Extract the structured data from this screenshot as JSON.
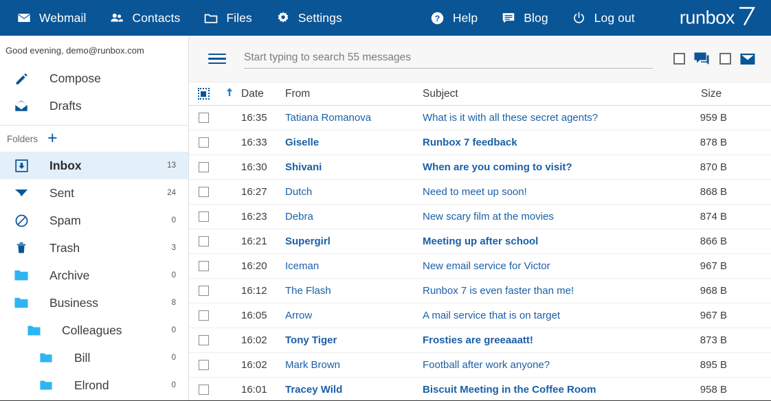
{
  "topnav": {
    "left_items": [
      {
        "label": "Webmail",
        "icon": "envelope-icon"
      },
      {
        "label": "Contacts",
        "icon": "people-icon"
      },
      {
        "label": "Files",
        "icon": "folder-icon"
      },
      {
        "label": "Settings",
        "icon": "gear-icon"
      }
    ],
    "right_items": [
      {
        "label": "Help",
        "icon": "help-circle-icon"
      },
      {
        "label": "Blog",
        "icon": "blog-icon"
      },
      {
        "label": "Log out",
        "icon": "power-icon"
      }
    ],
    "logo_word": "runbox",
    "logo_number": "7"
  },
  "sidebar": {
    "greeting": "Good evening, demo@runbox.com",
    "actions": [
      {
        "label": "Compose",
        "icon": "pencil-icon"
      },
      {
        "label": "Drafts",
        "icon": "open-envelope-icon"
      }
    ],
    "folders_label": "Folders",
    "add_folder": "+",
    "folders": [
      {
        "label": "Inbox",
        "count": "13",
        "icon": "inbox-icon",
        "indent": 0,
        "selected": true
      },
      {
        "label": "Sent",
        "count": "24",
        "icon": "sent-icon",
        "indent": 0,
        "selected": false
      },
      {
        "label": "Spam",
        "count": "0",
        "icon": "spam-icon",
        "indent": 0,
        "selected": false
      },
      {
        "label": "Trash",
        "count": "3",
        "icon": "trash-icon",
        "indent": 0,
        "selected": false
      },
      {
        "label": "Archive",
        "count": "0",
        "icon": "folder-icon",
        "indent": 0,
        "selected": false
      },
      {
        "label": "Business",
        "count": "8",
        "icon": "folder-icon",
        "indent": 0,
        "selected": false
      },
      {
        "label": "Colleagues",
        "count": "0",
        "icon": "folder-icon",
        "indent": 1,
        "selected": false
      },
      {
        "label": "Bill",
        "count": "0",
        "icon": "folder-icon",
        "indent": 2,
        "selected": false
      },
      {
        "label": "Elrond",
        "count": "0",
        "icon": "folder-icon",
        "indent": 2,
        "selected": false
      }
    ]
  },
  "toolbar": {
    "menu_icon": "hamburger-icon",
    "search_placeholder": "Start typing to search 55 messages",
    "search_value": "",
    "toggles": [
      {
        "icon": "chat-bubble-icon",
        "checked": false
      },
      {
        "icon": "envelope-icon",
        "checked": false
      }
    ]
  },
  "messagelist": {
    "select_all_icon": "select-all-icon",
    "sort_icon": "sort-ascending-arrow-icon",
    "columns": {
      "date": "Date",
      "from": "From",
      "subject": "Subject",
      "size": "Size"
    },
    "rows": [
      {
        "time": "16:35",
        "from": "Tatiana Romanova",
        "subject": "What is it with all these secret agents?",
        "size": "959 B",
        "unread": false
      },
      {
        "time": "16:33",
        "from": "Giselle",
        "subject": "Runbox 7 feedback",
        "size": "878 B",
        "unread": true
      },
      {
        "time": "16:30",
        "from": "Shivani",
        "subject": "When are you coming to visit?",
        "size": "870 B",
        "unread": true
      },
      {
        "time": "16:27",
        "from": "Dutch",
        "subject": "Need to meet up soon!",
        "size": "868 B",
        "unread": false
      },
      {
        "time": "16:23",
        "from": "Debra",
        "subject": "New scary film at the movies",
        "size": "874 B",
        "unread": false
      },
      {
        "time": "16:21",
        "from": "Supergirl",
        "subject": "Meeting up after school",
        "size": "866 B",
        "unread": true
      },
      {
        "time": "16:20",
        "from": "Iceman",
        "subject": "New email service for Victor",
        "size": "967 B",
        "unread": false
      },
      {
        "time": "16:12",
        "from": "The Flash",
        "subject": "Runbox 7 is even faster than me!",
        "size": "968 B",
        "unread": false
      },
      {
        "time": "16:05",
        "from": "Arrow",
        "subject": "A mail service that is on target",
        "size": "967 B",
        "unread": false
      },
      {
        "time": "16:02",
        "from": "Tony Tiger",
        "subject": "Frosties are greeaaatt!",
        "size": "873 B",
        "unread": true
      },
      {
        "time": "16:02",
        "from": "Mark Brown",
        "subject": "Football after work anyone?",
        "size": "895 B",
        "unread": false
      },
      {
        "time": "16:01",
        "from": "Tracey Wild",
        "subject": "Biscuit Meeting in the Coffee Room",
        "size": "958 B",
        "unread": true
      }
    ]
  },
  "colors": {
    "brand_blue": "#0a5596",
    "folder_blue": "#2fb5f2",
    "link_blue": "#1a5fa8",
    "selected_bg": "#e3f0fa"
  }
}
